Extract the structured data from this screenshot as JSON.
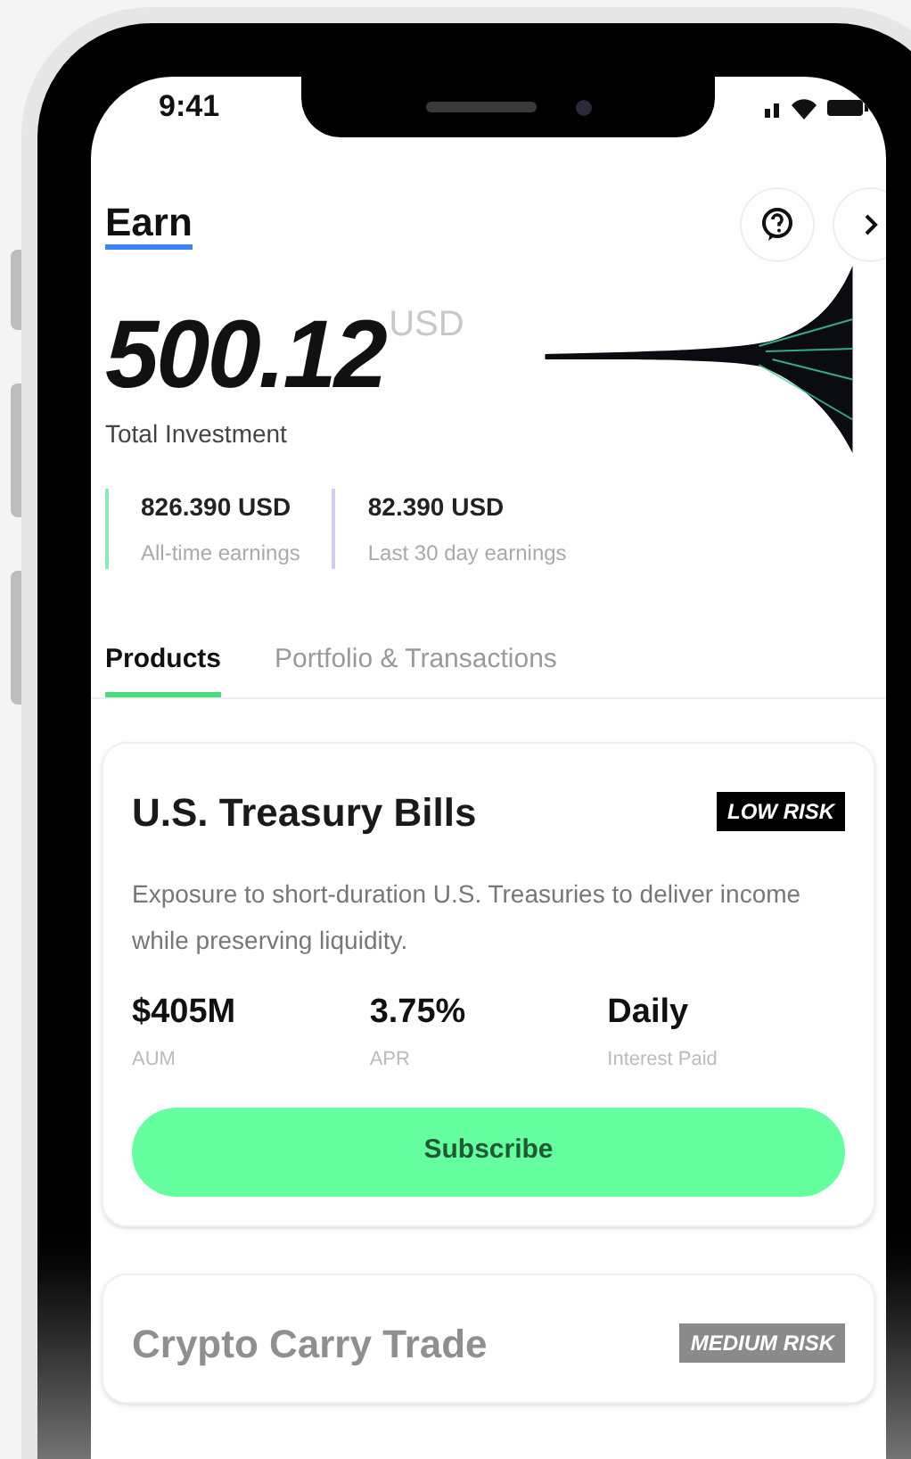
{
  "status_bar": {
    "time": "9:41"
  },
  "header": {
    "title": "Earn"
  },
  "total": {
    "amount": "500.12",
    "currency": "USD",
    "label": "Total Investment"
  },
  "stats": [
    {
      "value": "826.390 USD",
      "label": "All-time earnings",
      "color": "#8fe8bd"
    },
    {
      "value": "82.390 USD",
      "label": "Last 30 day earnings",
      "color": "#cfcdf2"
    }
  ],
  "tabs": [
    {
      "label": "Products",
      "selected": true
    },
    {
      "label": "Portfolio & Transactions",
      "selected": false
    }
  ],
  "products": [
    {
      "name": "U.S. Treasury Bills",
      "risk": "LOW RISK",
      "kind": "low",
      "dimmed": false,
      "description": "Exposure to short-duration U.S. Treasuries to deliver income while preserving liquidity.",
      "metrics": [
        {
          "value": "$405M",
          "label": "AUM"
        },
        {
          "value": "3.75%",
          "label": "APR"
        },
        {
          "value": "Daily",
          "label": "Interest Paid"
        }
      ],
      "button": "Subscribe"
    },
    {
      "name": "Crypto Carry Trade",
      "risk": "MEDIUM RISK",
      "kind": "medium",
      "dimmed": true
    }
  ]
}
